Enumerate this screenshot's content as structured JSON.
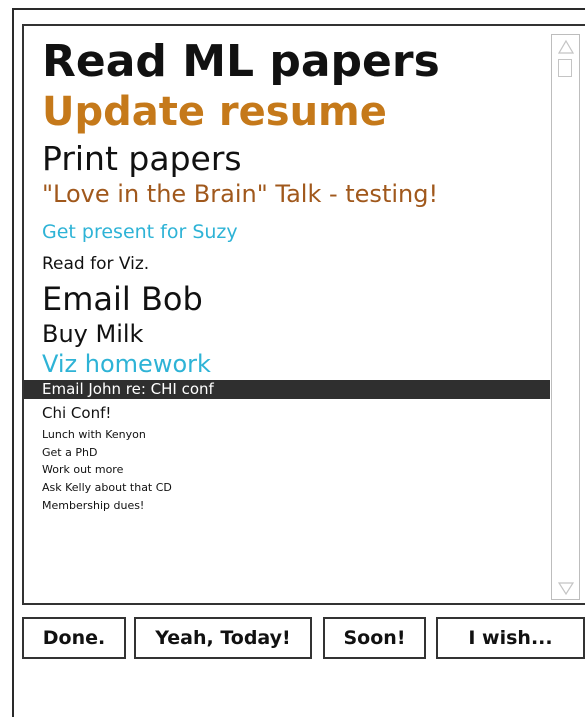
{
  "tasks": [
    {
      "label": "Read ML papers",
      "color": "#111111",
      "weight": "bold",
      "size": 44
    },
    {
      "label": "Update resume",
      "color": "#c5791a",
      "weight": "bold",
      "size": 40
    },
    {
      "label": "Print papers",
      "color": "#111111",
      "weight": "normal",
      "size": 33
    },
    {
      "label": "\"Love in the Brain\" Talk - testing!",
      "color": "#a0581c",
      "weight": "normal",
      "size": 24
    },
    {
      "label": "Get present for Suzy",
      "color": "#2eb3d6",
      "weight": "normal",
      "size": 19
    },
    {
      "label": "Read for Viz.",
      "color": "#111111",
      "weight": "normal",
      "size": 17
    },
    {
      "label": "Email Bob",
      "color": "#111111",
      "weight": "normal",
      "size": 32
    },
    {
      "label": "Buy Milk",
      "color": "#111111",
      "weight": "normal",
      "size": 24
    },
    {
      "label": "Viz homework",
      "color": "#2eb3d6",
      "weight": "normal",
      "size": 24
    },
    {
      "label": "Email John re: CHI conf",
      "color": "#ffffff",
      "weight": "normal",
      "size": 15,
      "selected": true
    },
    {
      "label": "Chi Conf!",
      "color": "#111111",
      "weight": "normal",
      "size": 15
    },
    {
      "label": "Lunch with Kenyon",
      "color": "#111111",
      "weight": "normal",
      "size": 11
    },
    {
      "label": "Get a PhD",
      "color": "#111111",
      "weight": "normal",
      "size": 11
    },
    {
      "label": "Work out more",
      "color": "#111111",
      "weight": "normal",
      "size": 11
    },
    {
      "label": "Ask Kelly about that CD",
      "color": "#111111",
      "weight": "normal",
      "size": 11
    },
    {
      "label": "Membership dues!",
      "color": "#111111",
      "weight": "normal",
      "size": 11
    }
  ],
  "scrollbar": {
    "up_icon": "triangle-up",
    "down_icon": "triangle-down"
  },
  "buttons": {
    "done": "Done.",
    "today": "Yeah, Today!",
    "soon": "Soon!",
    "wish": "I wish..."
  }
}
